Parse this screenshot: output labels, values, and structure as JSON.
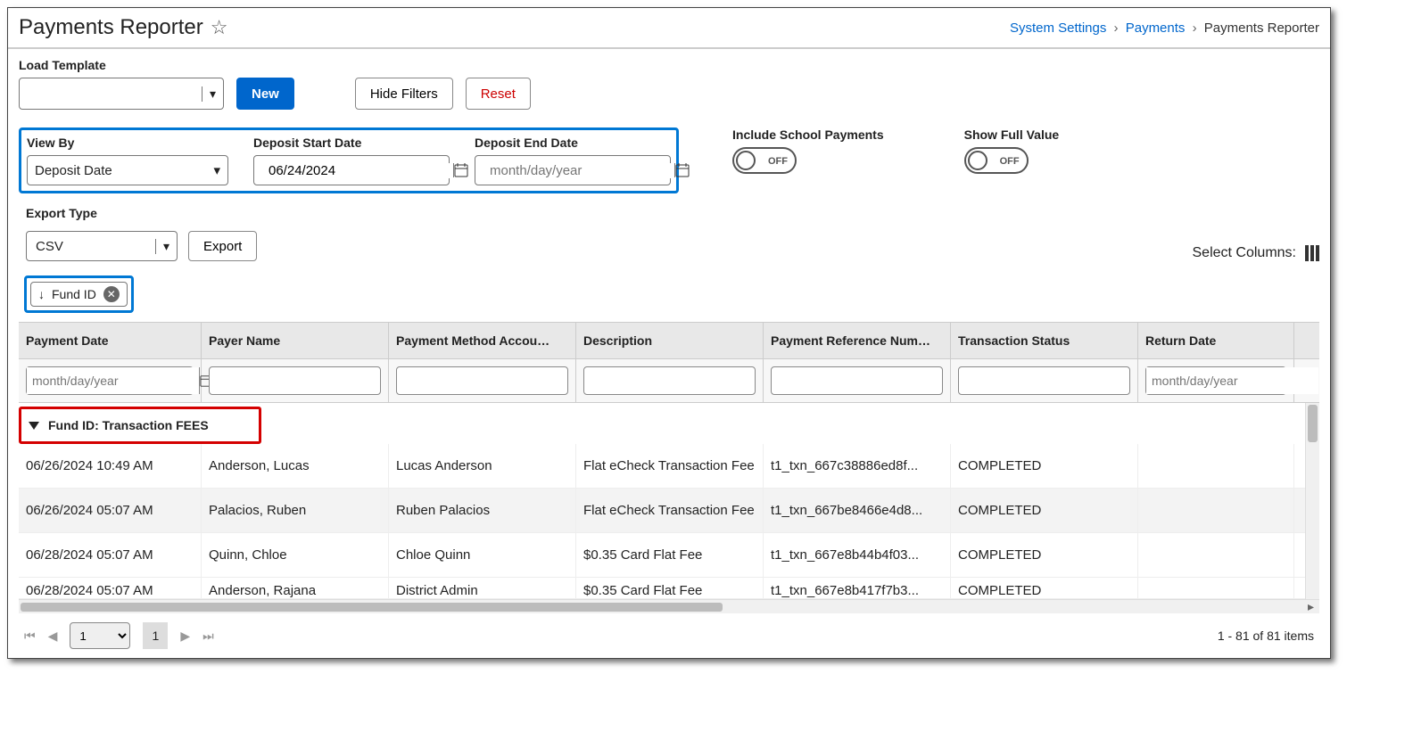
{
  "header": {
    "title": "Payments Reporter",
    "breadcrumb": {
      "link1": "System Settings",
      "link2": "Payments",
      "current": "Payments Reporter"
    }
  },
  "loadTemplate": {
    "label": "Load Template",
    "newBtn": "New",
    "hideFilters": "Hide Filters",
    "reset": "Reset"
  },
  "filters": {
    "viewBy": {
      "label": "View By",
      "value": "Deposit Date"
    },
    "depositStart": {
      "label": "Deposit Start Date",
      "value": "06/24/2024"
    },
    "depositEnd": {
      "label": "Deposit End Date",
      "placeholder": "month/day/year"
    },
    "includeSchool": {
      "label": "Include School Payments",
      "value": "OFF"
    },
    "showFull": {
      "label": "Show Full Value",
      "value": "OFF"
    }
  },
  "export": {
    "label": "Export Type",
    "type": "CSV",
    "btn": "Export",
    "selectColumns": "Select Columns:"
  },
  "groupChip": {
    "sortIcon": "↓",
    "label": "Fund ID"
  },
  "columns": {
    "c0": "Payment Date",
    "c1": "Payer Name",
    "c2": "Payment Method Accou…",
    "c3": "Description",
    "c4": "Payment Reference Num…",
    "c5": "Transaction Status",
    "c6": "Return Date"
  },
  "columnFilters": {
    "c0_placeholder": "month/day/year",
    "c6_placeholder": "month/day/year"
  },
  "groupHeader": "Fund ID: Transaction FEES",
  "rows": [
    {
      "c0": "06/26/2024 10:49 AM",
      "c1": "Anderson, Lucas",
      "c2": "Lucas Anderson",
      "c3": "Flat eCheck Transaction Fee",
      "c4": "t1_txn_667c38886ed8f...",
      "c5": "COMPLETED",
      "c6": ""
    },
    {
      "c0": "06/26/2024 05:07 AM",
      "c1": "Palacios, Ruben",
      "c2": "Ruben Palacios",
      "c3": "Flat eCheck Transaction Fee",
      "c4": "t1_txn_667be8466e4d8...",
      "c5": "COMPLETED",
      "c6": ""
    },
    {
      "c0": "06/28/2024 05:07 AM",
      "c1": "Quinn, Chloe",
      "c2": "Chloe Quinn",
      "c3": "$0.35 Card Flat Fee",
      "c4": "t1_txn_667e8b44b4f03...",
      "c5": "COMPLETED",
      "c6": ""
    },
    {
      "c0": "06/28/2024 05:07 AM",
      "c1": "Anderson, Rajana",
      "c2": "District Admin",
      "c3": "$0.35 Card Flat Fee",
      "c4": "t1_txn_667e8b417f7b3...",
      "c5": "COMPLETED",
      "c6": ""
    }
  ],
  "pager": {
    "current": "1",
    "pageBtn": "1",
    "summary": "1 - 81 of 81 items"
  }
}
